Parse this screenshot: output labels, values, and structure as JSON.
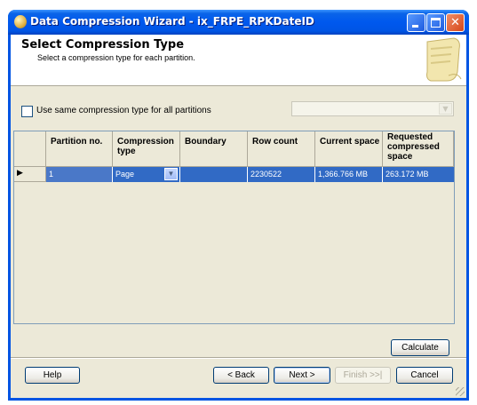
{
  "window": {
    "title": "Data Compression Wizard - ix_FRPE_RPKDateID"
  },
  "header": {
    "title": "Select Compression Type",
    "subtitle": "Select a compression type for each partition."
  },
  "options": {
    "same_type_label": "Use same compression type for all partitions",
    "same_type_checked": false
  },
  "grid": {
    "columns": [
      "Partition no.",
      "Compression type",
      "Boundary",
      "Row count",
      "Current space",
      "Requested compressed space"
    ],
    "rows": [
      {
        "partition": "1",
        "compression": "Page",
        "boundary": "",
        "row_count": "2230522",
        "current_space": "1,366.766 MB",
        "requested_space": "263.172 MB",
        "selected": true
      }
    ]
  },
  "buttons": {
    "calculate": "Calculate",
    "help": "Help",
    "back": "< Back",
    "next": "Next >",
    "finish": "Finish >>|",
    "cancel": "Cancel"
  },
  "colors": {
    "title_bar": "#0054e3",
    "selection": "#316ac5",
    "face": "#ece9d8"
  },
  "icons": [
    "app-icon",
    "minimize-icon",
    "maximize-icon",
    "close-icon",
    "scroll-icon",
    "dropdown-arrow-icon",
    "row-pointer-icon"
  ]
}
